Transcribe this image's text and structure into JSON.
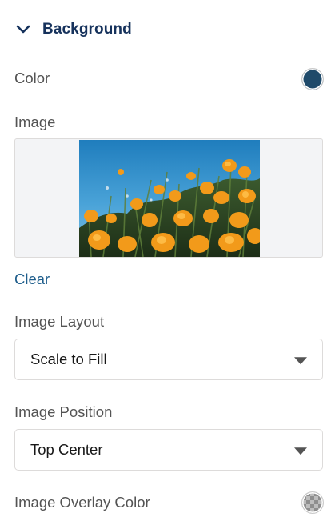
{
  "section": {
    "title": "Background",
    "icon": "chevron-down-icon"
  },
  "color": {
    "label": "Color",
    "value": "#1f4a6a"
  },
  "image": {
    "label": "Image",
    "clear_label": "Clear"
  },
  "image_layout": {
    "label": "Image Layout",
    "selected": "Scale to Fill"
  },
  "image_position": {
    "label": "Image Position",
    "selected": "Top Center"
  },
  "overlay": {
    "label": "Image Overlay Color",
    "icon": "checkerboard-transparent-swatch"
  }
}
